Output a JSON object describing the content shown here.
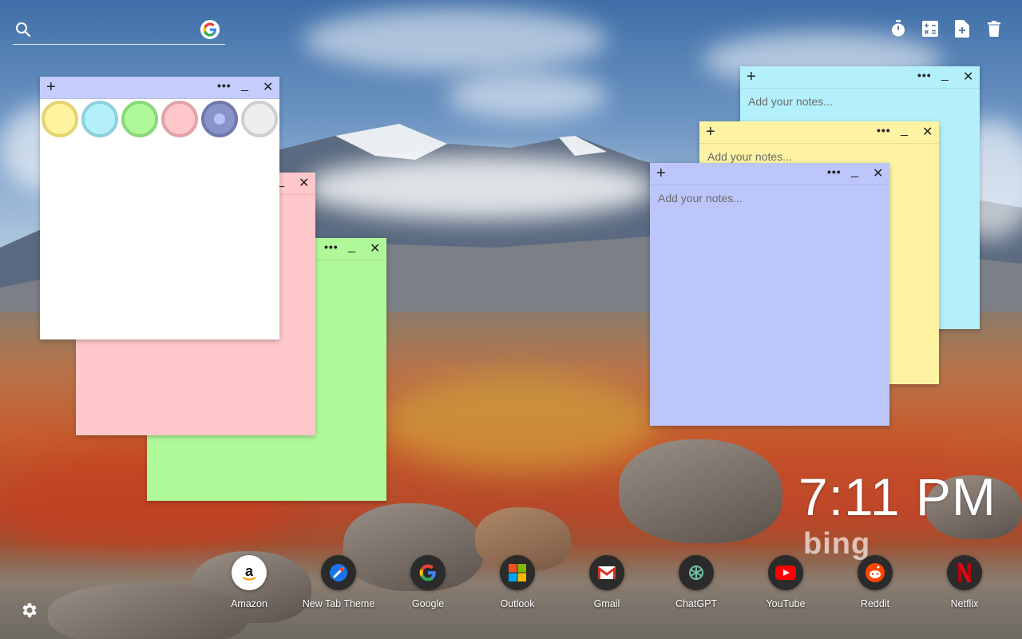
{
  "search": {
    "placeholder": "",
    "engine_icon": "google-icon"
  },
  "top_tools": [
    {
      "name": "timer-icon"
    },
    {
      "name": "calculator-icon"
    },
    {
      "name": "add-note-icon"
    },
    {
      "name": "trash-icon"
    }
  ],
  "notes": {
    "cyan": {
      "color": "#b3f0fb",
      "placeholder": "Add your notes...",
      "plus": "+",
      "more": "•••",
      "min": "_",
      "close": "✕"
    },
    "yellow": {
      "color": "#fdf3a3",
      "placeholder": "Add your notes...",
      "plus": "+",
      "more": "•••",
      "min": "_",
      "close": "✕"
    },
    "blue": {
      "color": "#bcc6fb",
      "placeholder": "Add your notes...",
      "plus": "+",
      "more": "•••",
      "min": "_",
      "close": "✕"
    },
    "pink": {
      "color": "#fec7c9",
      "min": "_",
      "close": "✕"
    },
    "green": {
      "color": "#b0f999",
      "more": "•••",
      "min": "_",
      "close": "✕"
    },
    "white": {
      "color": "#ffffff",
      "plus": "+",
      "more": "•••",
      "min": "_",
      "close": "✕",
      "swatches": [
        {
          "name": "yellow",
          "color": "#fef39f"
        },
        {
          "name": "cyan",
          "color": "#b3f0fb"
        },
        {
          "name": "green",
          "color": "#b0f999"
        },
        {
          "name": "pink",
          "color": "#fec7c9"
        },
        {
          "name": "blue",
          "color": "#8893c9",
          "selected": true
        },
        {
          "name": "white",
          "color": "#eeeeee"
        }
      ]
    }
  },
  "clock": {
    "time": "7:11 PM"
  },
  "bing": {
    "text": "bing"
  },
  "shortcuts": [
    {
      "label": "Amazon",
      "icon": "amazon-icon"
    },
    {
      "label": "New Tab Theme",
      "icon": "new-tab-theme-icon"
    },
    {
      "label": "Google",
      "icon": "google-icon"
    },
    {
      "label": "Outlook",
      "icon": "outlook-icon"
    },
    {
      "label": "Gmail",
      "icon": "gmail-icon"
    },
    {
      "label": "ChatGPT",
      "icon": "chatgpt-icon"
    },
    {
      "label": "YouTube",
      "icon": "youtube-icon"
    },
    {
      "label": "Reddit",
      "icon": "reddit-icon"
    },
    {
      "label": "Netflix",
      "icon": "netflix-icon"
    }
  ],
  "settings": {
    "icon": "gear-icon"
  }
}
